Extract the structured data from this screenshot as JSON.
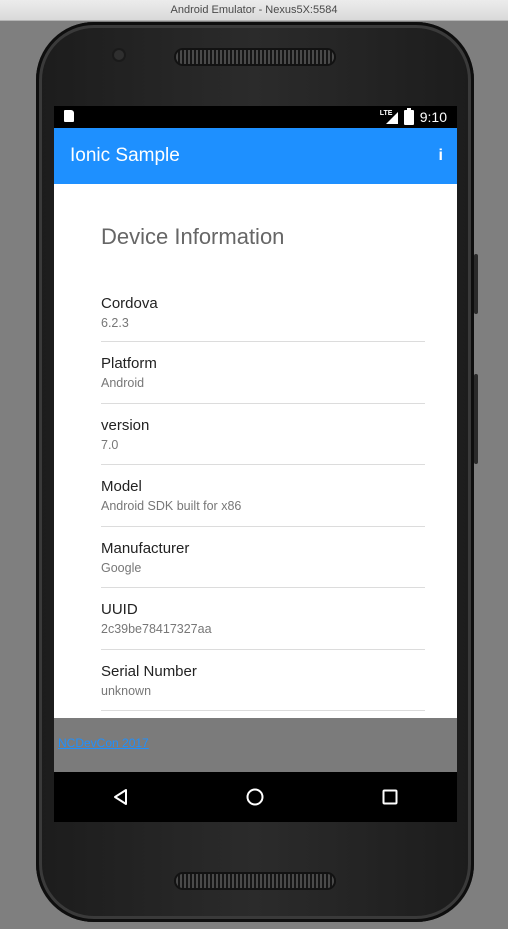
{
  "window": {
    "title": "Android Emulator - Nexus5X:5584"
  },
  "statusbar": {
    "network": "LTE",
    "time": "9:10"
  },
  "toolbar": {
    "title": "Ionic Sample",
    "info_label": "i"
  },
  "page": {
    "heading": "Device Information"
  },
  "device_info": [
    {
      "label": "Cordova",
      "value": "6.2.3"
    },
    {
      "label": "Platform",
      "value": "Android"
    },
    {
      "label": "version",
      "value": "7.0"
    },
    {
      "label": "Model",
      "value": "Android SDK built for x86"
    },
    {
      "label": "Manufacturer",
      "value": "Google"
    },
    {
      "label": "UUID",
      "value": "2c39be78417327aa"
    },
    {
      "label": "Serial Number",
      "value": "unknown"
    }
  ],
  "footer": {
    "link_text": "NCDevCon 2017"
  },
  "navbar": {
    "icons": [
      "back-icon",
      "home-icon",
      "recents-icon"
    ]
  },
  "colors": {
    "toolbar": "#1e90ff",
    "footer": "#7b7b7b",
    "background": "#7f7f7f"
  }
}
